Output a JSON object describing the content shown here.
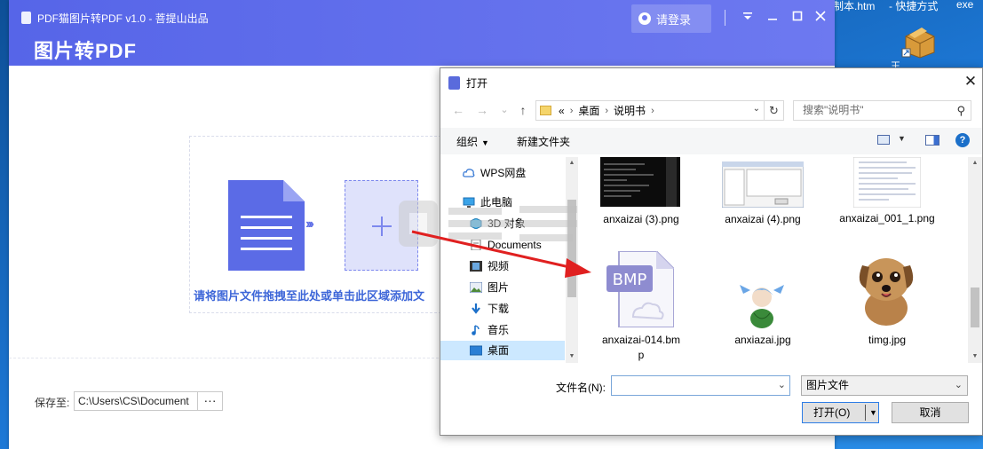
{
  "desktop": {
    "top_labels": [
      "制本.htm",
      "- 快捷方式",
      "exe"
    ],
    "shortcut_label": "王..."
  },
  "app": {
    "title": "PDF猫图片转PDF v1.0 - 菩提山出品",
    "heading": "图片转PDF",
    "login_label": "请登录",
    "window_controls": {
      "menu_icon": "dropdown-menu-icon",
      "minimize_icon": "minimize-icon",
      "maximize_icon": "maximize-icon",
      "close_icon": "close-icon"
    },
    "drop_text": "请将图片文件拖拽至此处或单击此区域添加文",
    "save_label": "保存至:",
    "save_path": "C:\\Users\\CS\\Document",
    "save_more": "···",
    "accent_color": "#5b6be6"
  },
  "dialog": {
    "title": "打开",
    "close_glyph": "✕",
    "nav": {
      "back": "←",
      "forward": "→",
      "recent": "⌄",
      "up": "↑"
    },
    "breadcrumb": [
      "«",
      "桌面",
      "说明书"
    ],
    "search_placeholder": "搜索\"说明书\"",
    "toolbar": {
      "organize": "组织",
      "new_folder": "新建文件夹",
      "help": "?"
    },
    "sidebar": [
      {
        "label": "WPS网盘",
        "icon": "cloud-icon"
      },
      {
        "label": "此电脑",
        "icon": "computer-icon"
      },
      {
        "label": "3D 对象",
        "icon": "cube-icon"
      },
      {
        "label": "Documents",
        "icon": "documents-icon"
      },
      {
        "label": "视频",
        "icon": "video-icon"
      },
      {
        "label": "图片",
        "icon": "pictures-icon"
      },
      {
        "label": "下载",
        "icon": "download-icon"
      },
      {
        "label": "音乐",
        "icon": "music-icon"
      },
      {
        "label": "桌面",
        "icon": "desktop-icon",
        "selected": true
      }
    ],
    "files": [
      {
        "name": "anxaizai (3).png",
        "thumb": "terminal-screenshot"
      },
      {
        "name": "anxaizai (4).png",
        "thumb": "window-screenshot"
      },
      {
        "name": "anxaizai_001_1.png",
        "thumb": "document-page"
      },
      {
        "name": "anxaizai-014.bmp",
        "thumb": "bmp-file-icon",
        "badge": "BMP"
      },
      {
        "name": "anxiazai.jpg",
        "thumb": "anime-girl-image"
      },
      {
        "name": "timg.jpg",
        "thumb": "puppy-image"
      }
    ],
    "filename_label": "文件名(N):",
    "filename_value": "",
    "filetype_value": "图片文件",
    "open_button": "打开(O)",
    "cancel_button": "取消"
  },
  "colors": {
    "header_start": "#5665e8",
    "header_end": "#6d79f0",
    "selection": "#cce8ff",
    "arrow": "#e02020"
  }
}
